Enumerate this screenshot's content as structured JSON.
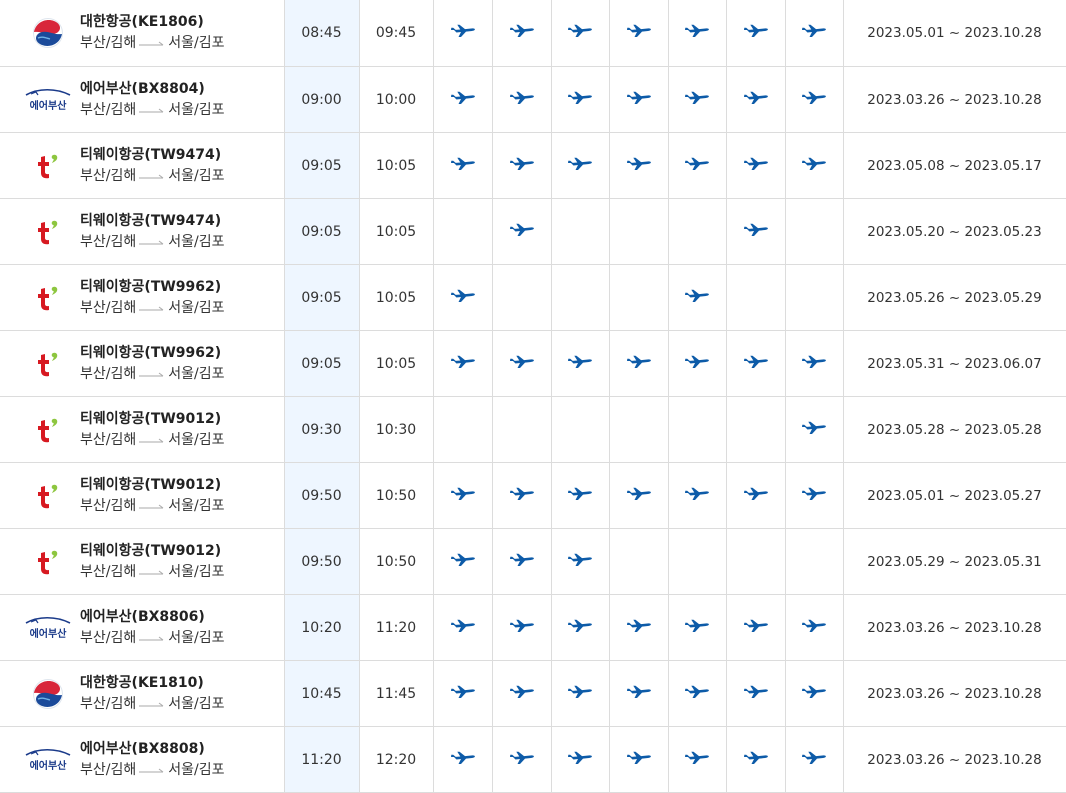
{
  "colors": {
    "plane": "#0d5ba8",
    "departure_bg": "#eef6ff",
    "grid": "#dcdcdc"
  },
  "flights": [
    {
      "airline": "대한항공",
      "code": "KE1806",
      "logo": "korean-air-logo",
      "from": "부산/김해",
      "to": "서울/김포",
      "dep": "08:45",
      "arr": "09:45",
      "days": [
        1,
        1,
        1,
        1,
        1,
        1,
        1
      ],
      "period": "2023.05.01 ~ 2023.10.28"
    },
    {
      "airline": "에어부산",
      "code": "BX8804",
      "logo": "air-busan-logo",
      "logo_text": "에어부산",
      "from": "부산/김해",
      "to": "서울/김포",
      "dep": "09:00",
      "arr": "10:00",
      "days": [
        1,
        1,
        1,
        1,
        1,
        1,
        1
      ],
      "period": "2023.03.26 ~ 2023.10.28"
    },
    {
      "airline": "티웨이항공",
      "code": "TW9474",
      "logo": "tway-logo",
      "from": "부산/김해",
      "to": "서울/김포",
      "dep": "09:05",
      "arr": "10:05",
      "days": [
        1,
        1,
        1,
        1,
        1,
        1,
        1
      ],
      "period": "2023.05.08 ~ 2023.05.17"
    },
    {
      "airline": "티웨이항공",
      "code": "TW9474",
      "logo": "tway-logo",
      "from": "부산/김해",
      "to": "서울/김포",
      "dep": "09:05",
      "arr": "10:05",
      "days": [
        0,
        1,
        0,
        0,
        0,
        1,
        0
      ],
      "period": "2023.05.20 ~ 2023.05.23"
    },
    {
      "airline": "티웨이항공",
      "code": "TW9962",
      "logo": "tway-logo",
      "from": "부산/김해",
      "to": "서울/김포",
      "dep": "09:05",
      "arr": "10:05",
      "days": [
        1,
        0,
        0,
        0,
        1,
        0,
        0
      ],
      "period": "2023.05.26 ~ 2023.05.29"
    },
    {
      "airline": "티웨이항공",
      "code": "TW9962",
      "logo": "tway-logo",
      "from": "부산/김해",
      "to": "서울/김포",
      "dep": "09:05",
      "arr": "10:05",
      "days": [
        1,
        1,
        1,
        1,
        1,
        1,
        1
      ],
      "period": "2023.05.31 ~ 2023.06.07"
    },
    {
      "airline": "티웨이항공",
      "code": "TW9012",
      "logo": "tway-logo",
      "from": "부산/김해",
      "to": "서울/김포",
      "dep": "09:30",
      "arr": "10:30",
      "days": [
        0,
        0,
        0,
        0,
        0,
        0,
        1
      ],
      "period": "2023.05.28 ~ 2023.05.28"
    },
    {
      "airline": "티웨이항공",
      "code": "TW9012",
      "logo": "tway-logo",
      "from": "부산/김해",
      "to": "서울/김포",
      "dep": "09:50",
      "arr": "10:50",
      "days": [
        1,
        1,
        1,
        1,
        1,
        1,
        1
      ],
      "period": "2023.05.01 ~ 2023.05.27"
    },
    {
      "airline": "티웨이항공",
      "code": "TW9012",
      "logo": "tway-logo",
      "from": "부산/김해",
      "to": "서울/김포",
      "dep": "09:50",
      "arr": "10:50",
      "days": [
        1,
        1,
        1,
        0,
        0,
        0,
        0
      ],
      "period": "2023.05.29 ~ 2023.05.31"
    },
    {
      "airline": "에어부산",
      "code": "BX8806",
      "logo": "air-busan-logo",
      "logo_text": "에어부산",
      "from": "부산/김해",
      "to": "서울/김포",
      "dep": "10:20",
      "arr": "11:20",
      "days": [
        1,
        1,
        1,
        1,
        1,
        1,
        1
      ],
      "period": "2023.03.26 ~ 2023.10.28"
    },
    {
      "airline": "대한항공",
      "code": "KE1810",
      "logo": "korean-air-logo",
      "from": "부산/김해",
      "to": "서울/김포",
      "dep": "10:45",
      "arr": "11:45",
      "days": [
        1,
        1,
        1,
        1,
        1,
        1,
        1
      ],
      "period": "2023.03.26 ~ 2023.10.28"
    },
    {
      "airline": "에어부산",
      "code": "BX8808",
      "logo": "air-busan-logo",
      "logo_text": "에어부산",
      "from": "부산/김해",
      "to": "서울/김포",
      "dep": "11:20",
      "arr": "12:20",
      "days": [
        1,
        1,
        1,
        1,
        1,
        1,
        1
      ],
      "period": "2023.03.26 ~ 2023.10.28"
    }
  ]
}
